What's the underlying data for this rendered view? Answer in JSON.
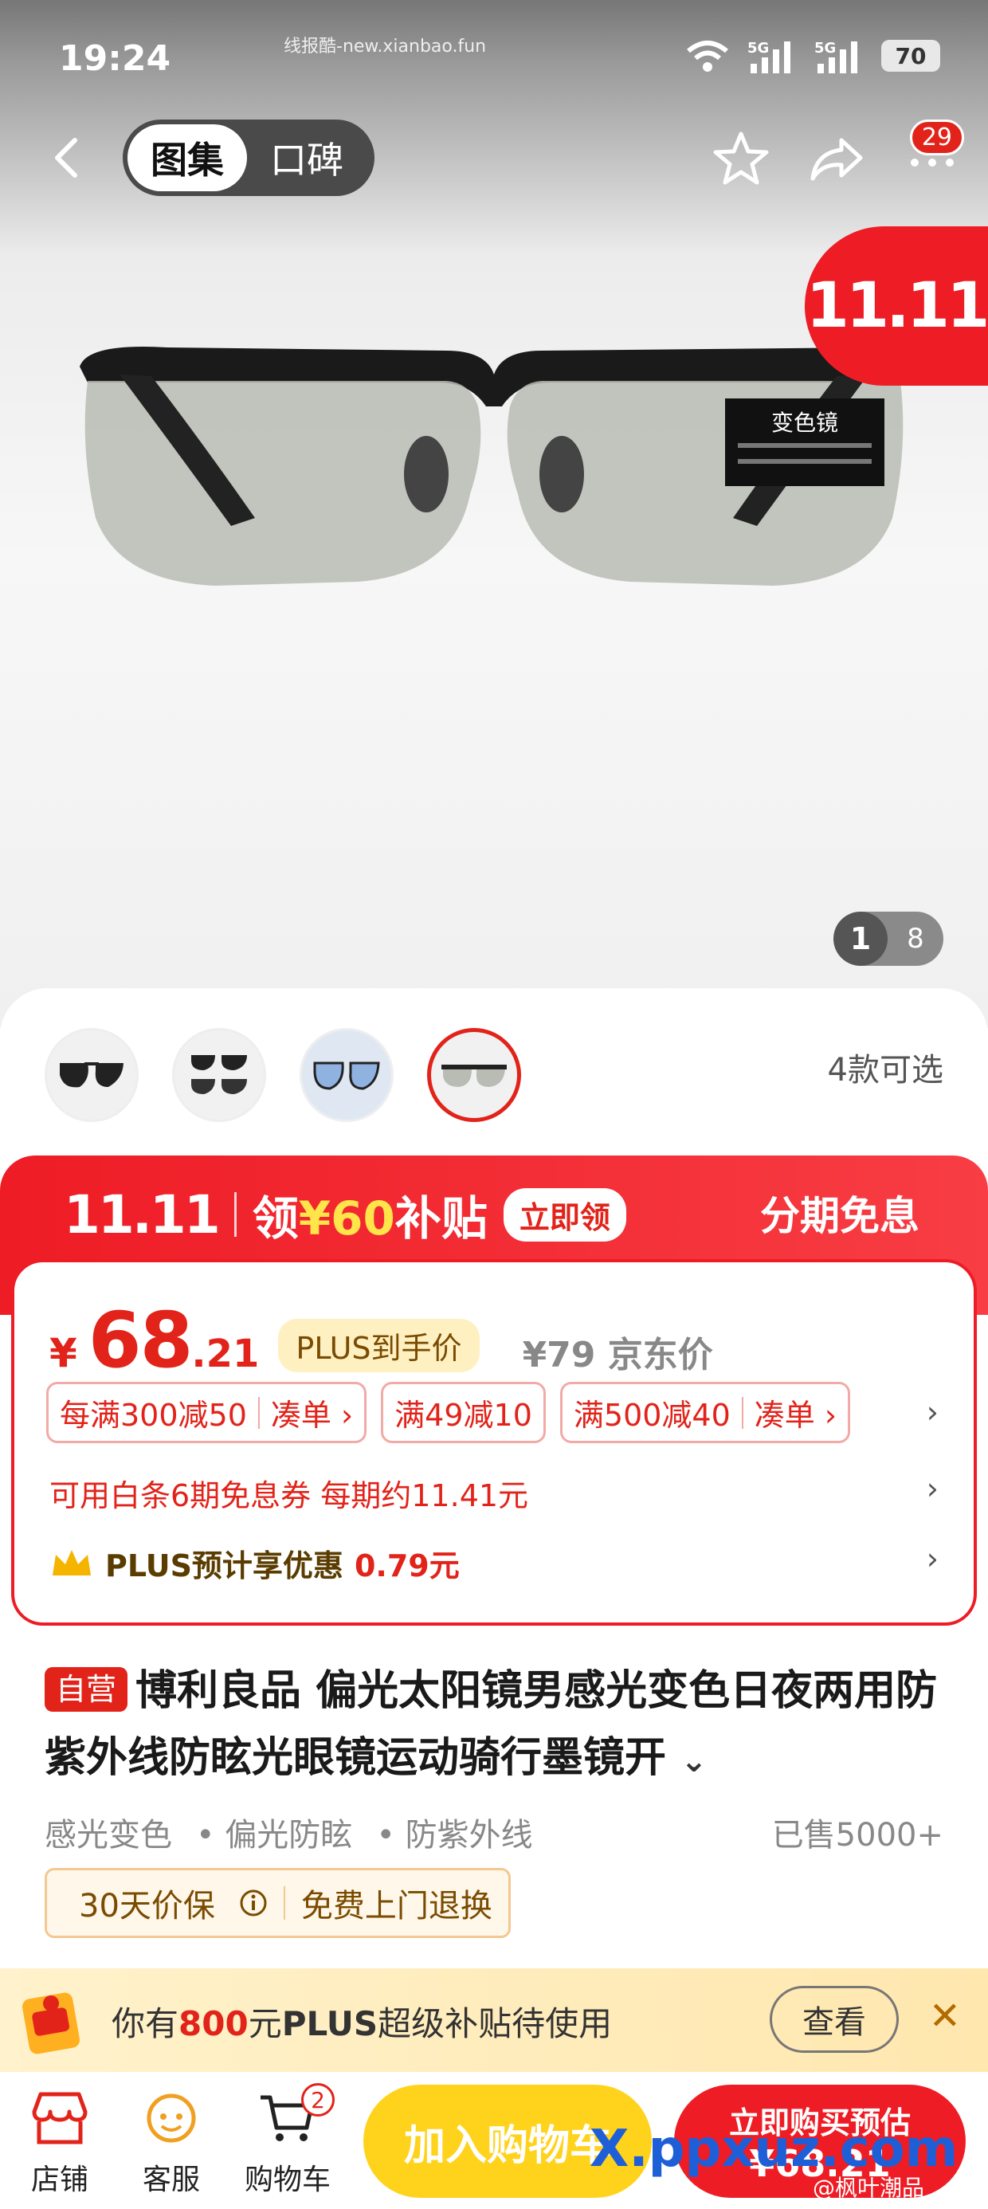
{
  "status": {
    "time": "19:24",
    "watermark": "线报酷-new.xianbao.fun",
    "battery": "70"
  },
  "nav": {
    "tab_gallery": "图集",
    "tab_reviews": "口碑",
    "more_badge": "29"
  },
  "gallery": {
    "promo_logo": "11.11",
    "product_label": "变色镜",
    "current": "1",
    "total": "8"
  },
  "variants": {
    "more_label": "4款可选",
    "items": [
      "black-metal-frame",
      "two-pairs-set",
      "blue-frame-set",
      "photochromic-selected"
    ]
  },
  "promo": {
    "logo": "11.11",
    "claim_prefix": "领",
    "amount": "¥60",
    "claim_suffix": "补贴",
    "claim_button": "立即领",
    "installment": "分期免息"
  },
  "price": {
    "currency": "¥",
    "integer": "68",
    "decimal": ".21",
    "plus_tag": "PLUS到手价",
    "jd_price": "¥79 京东价",
    "coupons": [
      {
        "main": "每满300减50",
        "action": "凑单 ›"
      },
      {
        "main": "满49减10",
        "action": ""
      },
      {
        "main": "满500减40",
        "action": "凑单 ›"
      }
    ],
    "baitiao": "可用白条6期免息券 每期约11.41元",
    "plus_saving_prefix": "PLUS预计享优惠",
    "plus_saving_value": "0.79元"
  },
  "product": {
    "self_tag": "自营",
    "title": "博利良品 偏光太阳镜男感光变色日夜两用防紫外线防眩光眼镜运动骑行墨镜开",
    "features": [
      "感光变色",
      "• 偏光防眩",
      "• 防紫外线"
    ],
    "sold": "已售5000+",
    "guarantee": [
      "30天价保",
      "免费上门退换"
    ]
  },
  "subsidy": {
    "prefix": "你有",
    "amount": "800",
    "unit": "元",
    "plus": "PLUS",
    "suffix": "超级补贴待使用",
    "view_button": "查看"
  },
  "bottom": {
    "store": "店铺",
    "service": "客服",
    "cart": "购物车",
    "cart_count": "2",
    "add_cart": "加入购物车",
    "buy_now_l1": "立即购买预估",
    "buy_now_l2": "¥68.21"
  },
  "watermarks": {
    "site": "X.ppxuz.com",
    "credit": "@枫叶潮品"
  },
  "colors": {
    "jd_red": "#e2231a",
    "promo_yellow": "#ffd31c",
    "plus_gold": "#fff0c2"
  }
}
